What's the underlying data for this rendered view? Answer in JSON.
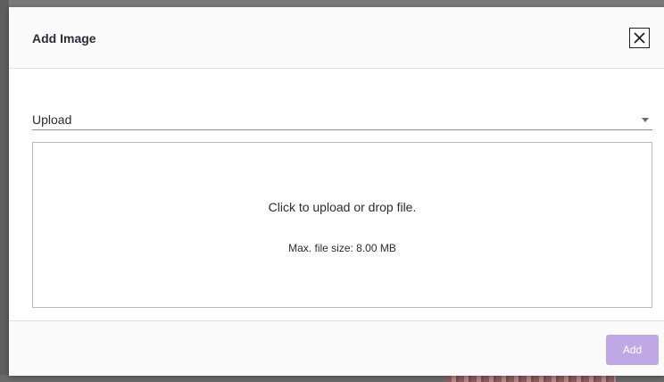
{
  "dialog": {
    "title": "Add Image",
    "close_icon": "close-icon"
  },
  "source": {
    "selected": "Upload",
    "icon": "caret-down-icon"
  },
  "dropzone": {
    "prompt": "Click to upload or drop file.",
    "limit": "Max. file size: 8.00 MB"
  },
  "footer": {
    "add_label": "Add",
    "add_disabled": true,
    "add_color": "#c0a7e6"
  }
}
